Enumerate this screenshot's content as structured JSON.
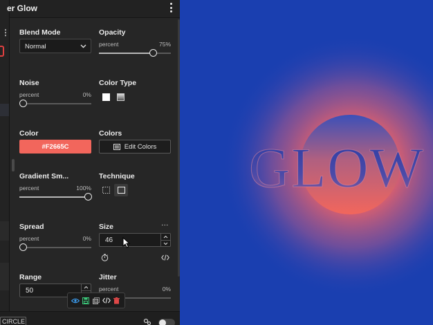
{
  "panel": {
    "title": "er Glow",
    "blend_mode": {
      "label": "Blend Mode",
      "value": "Normal"
    },
    "opacity": {
      "label": "Opacity",
      "unit": "percent",
      "value_text": "75%",
      "value": 0.75
    },
    "noise": {
      "label": "Noise",
      "unit": "percent",
      "value_text": "0%",
      "value": 0
    },
    "color_type": {
      "label": "Color Type",
      "options": [
        "solid",
        "gradient"
      ]
    },
    "color": {
      "label": "Color",
      "hex": "#F2665C",
      "swatch": "#F2665C"
    },
    "colors": {
      "label": "Colors",
      "button": "Edit Colors"
    },
    "gradient_smoothness": {
      "label": "Gradient Sm...",
      "unit": "percent",
      "value_text": "100%",
      "value": 1.0
    },
    "technique": {
      "label": "Technique"
    },
    "spread": {
      "label": "Spread",
      "unit": "percent",
      "value_text": "0%",
      "value": 0
    },
    "size": {
      "label": "Size",
      "value": "46",
      "more": "···"
    },
    "range": {
      "label": "Range",
      "value": "50"
    },
    "jitter": {
      "label": "Jitter",
      "unit": "percent",
      "value_text": "0%"
    }
  },
  "bottom": {
    "circle_label": "CIRCLE"
  },
  "canvas": {
    "text": "GLOW",
    "background": "#1a3fb0",
    "glow_color": "#F2665C"
  },
  "icons": [
    "kebab-menu-icon",
    "chevron-down-icon",
    "edit-colors-icon",
    "technique-softer-icon",
    "technique-precise-icon",
    "stopwatch-icon",
    "code-icon",
    "eye-icon",
    "save-icon",
    "copy-icon",
    "delete-icon",
    "mouse-cursor-icon",
    "settings-icon"
  ]
}
